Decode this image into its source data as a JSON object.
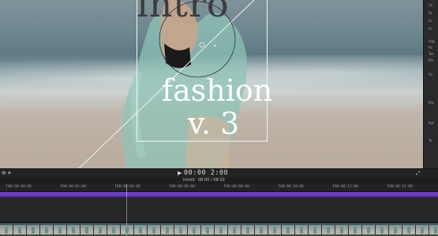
{
  "viewer": {
    "title_line1": "intro",
    "title_line2": "fashion",
    "title_line3": "v. 3"
  },
  "inspector": {
    "rows": [
      "Ce",
      "Fa",
      "Fo",
      "Fo",
      "Alig",
      "Pa",
      "Tex",
      "Blu",
      "Cu",
      "Pos",
      "Rot",
      "Ta"
    ]
  },
  "viewer_toolbar": {
    "zoom_label": "⊕ ▾",
    "play_icon": "▶",
    "timecode": "00:00 2:08",
    "fullscreen_icon": "⤢"
  },
  "timeline": {
    "project_name": "intro3",
    "duration": "08:00 / 08:10",
    "ruler_labels": [
      "00:00:00:00",
      "00:00:02:00",
      "00:00:04:00",
      "00:00:06:00",
      "00:00:08:00",
      "00:00:10:00",
      "00:00:12:00",
      "00:00:14:00"
    ]
  },
  "colors": {
    "accent_purple": "#6c3fb8",
    "panel_dark": "#1c1c1e",
    "title_white": "#ffffff"
  }
}
